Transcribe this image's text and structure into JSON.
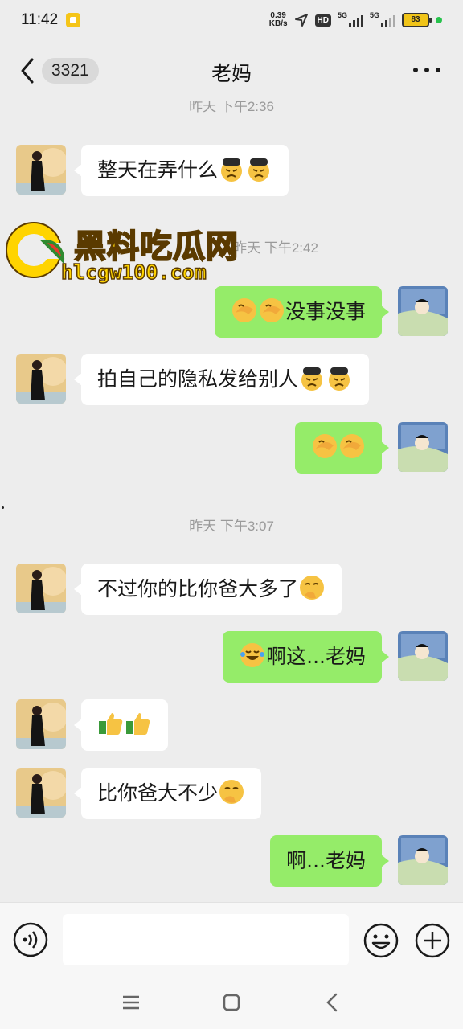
{
  "status_bar": {
    "time": "11:42",
    "net_speed_value": "0.39",
    "net_speed_unit": "KB/s",
    "hd_label": "HD",
    "signal1_label": "5G",
    "signal2_label": "5G",
    "battery": "83"
  },
  "header": {
    "unread_count": "3321",
    "title": "老妈"
  },
  "watermark": {
    "name": "黑料吃瓜网",
    "url": "hlcgw100.com"
  },
  "messages": [
    {
      "type": "time",
      "text": "昨天 下午2:36"
    },
    {
      "type": "msg",
      "side": "left",
      "text": "整天在弄什么",
      "emojis": [
        "tired-face-emoji",
        "tired-face-emoji"
      ]
    },
    {
      "type": "time",
      "text": "昨天 下午2:42"
    },
    {
      "type": "msg",
      "side": "right",
      "text": "没事没事",
      "emojis_before": [
        "facepalm-emoji",
        "facepalm-emoji"
      ]
    },
    {
      "type": "msg",
      "side": "left",
      "text": "拍自己的隐私发给别人",
      "emojis": [
        "tired-face-emoji",
        "tired-face-emoji"
      ]
    },
    {
      "type": "msg",
      "side": "right",
      "text": "",
      "emojis_before": [
        "facepalm-emoji",
        "facepalm-emoji"
      ]
    },
    {
      "type": "time",
      "text": "昨天 下午3:07"
    },
    {
      "type": "msg",
      "side": "left",
      "text": "不过你的比你爸大多了",
      "emojis": [
        "smirk-emoji"
      ]
    },
    {
      "type": "msg",
      "side": "right",
      "text": "啊这...老妈",
      "emojis_before": [
        "laugh-cry-emoji"
      ]
    },
    {
      "type": "msg",
      "side": "left",
      "text": "",
      "emojis": [
        "thumbs-up-emoji",
        "thumbs-up-emoji"
      ]
    },
    {
      "type": "msg",
      "side": "left",
      "text": "比你爸大不少",
      "emojis": [
        "smirk-emoji"
      ]
    },
    {
      "type": "msg",
      "side": "right",
      "text": "啊...老妈",
      "emojis_before": []
    }
  ],
  "input": {
    "placeholder": ""
  },
  "colors": {
    "background": "#ededed",
    "bubble_sent": "#95ec69",
    "bubble_received": "#ffffff",
    "timestamp": "#9a9a9a"
  }
}
